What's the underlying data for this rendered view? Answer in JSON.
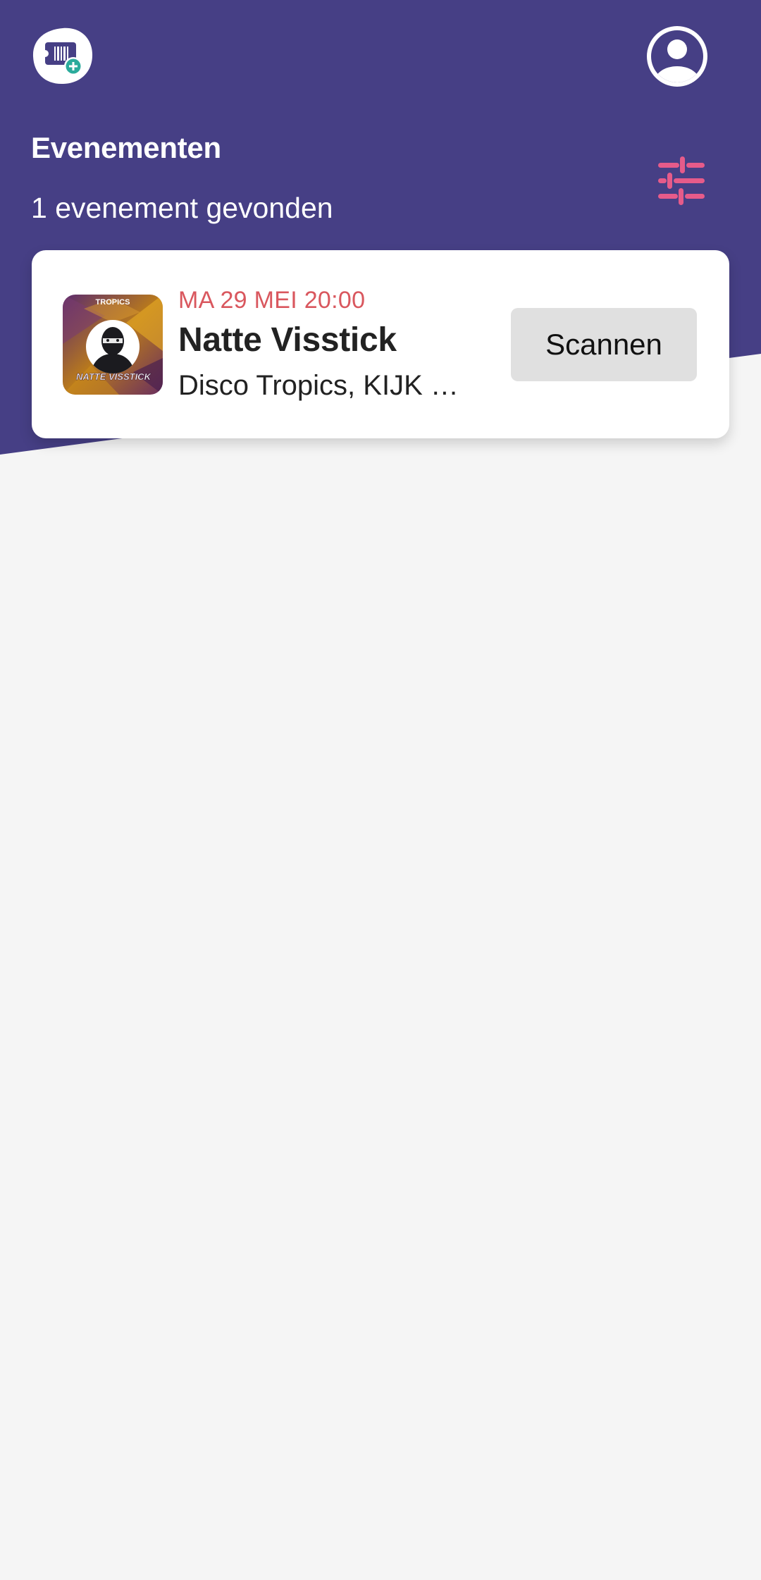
{
  "header": {
    "title": "Evenementen",
    "result_count": "1 evenement gevonden",
    "logo_icon": "ticket-add-icon",
    "profile_icon": "account-circle-icon",
    "filter_icon": "tune-sliders-icon"
  },
  "colors": {
    "header_bg": "#463f85",
    "accent": "#e65b8a",
    "date_text": "#d9575e",
    "page_bg": "#f5f5f5",
    "button_bg": "#e0e0e0"
  },
  "events": [
    {
      "date": "MA 29 MEI 20:00",
      "name": "Natte Visstick",
      "venue": "Disco Tropics, KIJK Rotterdam",
      "thumb_brand_text": "TROPICS",
      "thumb_title_text": "NATTE VISSTICK",
      "action_label": "Scannen"
    }
  ]
}
